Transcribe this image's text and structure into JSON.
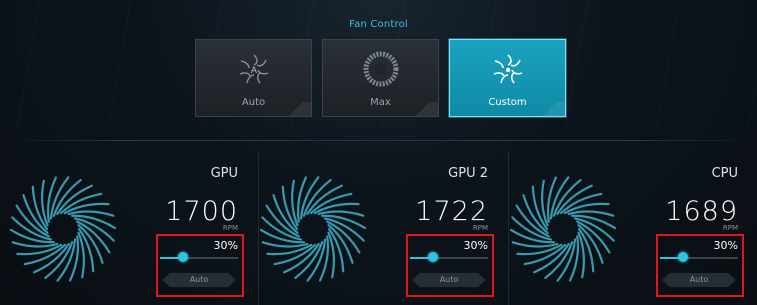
{
  "header": {
    "title": "Fan Control"
  },
  "modes": [
    {
      "label": "Auto",
      "icon": "fan-auto-icon",
      "active": false
    },
    {
      "label": "Max",
      "icon": "fan-max-icon",
      "active": false
    },
    {
      "label": "Custom",
      "icon": "fan-custom-icon",
      "active": true
    }
  ],
  "panels": [
    {
      "name": "GPU",
      "rpm": "1700",
      "unit": "RPM",
      "percent_label": "30%",
      "percent": 30,
      "auto_label": "Auto"
    },
    {
      "name": "GPU 2",
      "rpm": "1722",
      "unit": "RPM",
      "percent_label": "30%",
      "percent": 30,
      "auto_label": "Auto"
    },
    {
      "name": "CPU",
      "rpm": "1689",
      "unit": "RPM",
      "percent_label": "30%",
      "percent": 30,
      "auto_label": "Auto"
    }
  ],
  "colors": {
    "accent": "#2ec3e0",
    "highlight": "#e0161e",
    "active_tile": "#1ba3bf"
  }
}
